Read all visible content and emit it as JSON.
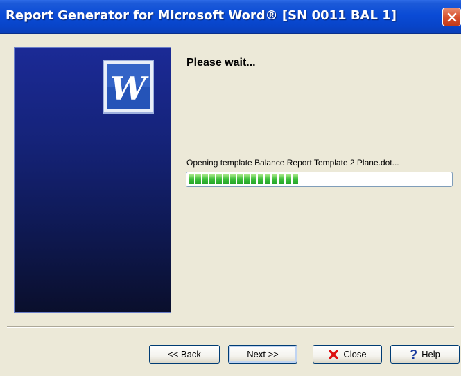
{
  "window": {
    "title": "Report Generator for Microsoft Word® [SN 0011 BAL 1]"
  },
  "main": {
    "heading": "Please wait...",
    "status": "Opening template Balance Report Template 2 Plane.dot...",
    "progress_fraction": 0.42
  },
  "buttons": {
    "back": "<< Back",
    "next": "Next >>",
    "close": "Close",
    "help": "Help"
  },
  "icons": {
    "close_icon": "close-icon",
    "word_logo": "word-logo-icon",
    "red_x": "red-x-icon",
    "help": "question-mark-icon"
  },
  "colors": {
    "titlebar": "#0a4bd6",
    "progress_fill": "#3fc03a",
    "panel": "#152379"
  }
}
